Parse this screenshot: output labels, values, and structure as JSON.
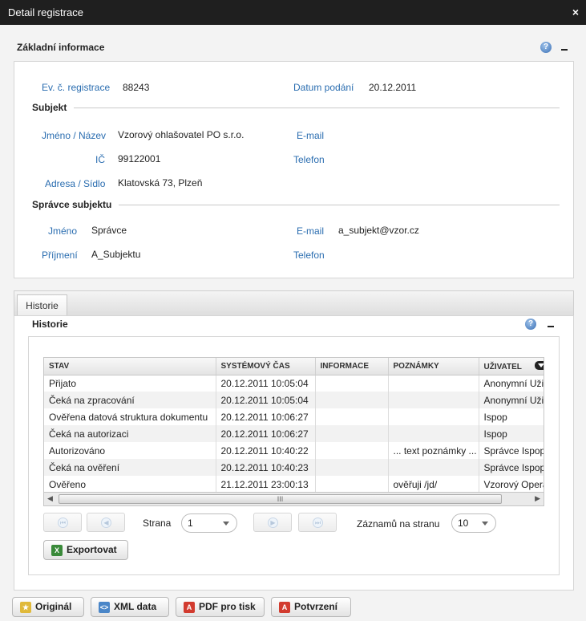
{
  "window": {
    "title": "Detail registrace",
    "close_symbol": "×"
  },
  "basic": {
    "title": "Základní informace",
    "evc_label": "Ev. č. registrace",
    "evc_value": "88243",
    "date_label": "Datum podání",
    "date_value": "20.12.2011",
    "subject": {
      "heading": "Subjekt",
      "name_label": "Jméno / Název",
      "name_value": "Vzorový ohlašovatel PO s.r.o.",
      "email_label": "E-mail",
      "email_value": "",
      "ic_label": "IČ",
      "ic_value": "99122001",
      "phone_label": "Telefon",
      "phone_value": "",
      "address_label": "Adresa / Sídlo",
      "address_value": "Klatovská 73, Plzeň"
    },
    "admin": {
      "heading": "Správce subjektu",
      "first_label": "Jméno",
      "first_value": "Správce",
      "email_label": "E-mail",
      "email_value": "a_subjekt@vzor.cz",
      "last_label": "Příjmení",
      "last_value": "A_Subjektu",
      "phone_label": "Telefon",
      "phone_value": ""
    }
  },
  "history": {
    "tab_label": "Historie",
    "title": "Historie",
    "columns": [
      "STAV",
      "SYSTÉMOVÝ ČAS",
      "INFORMACE",
      "POZNÁMKY",
      "UŽIVATEL"
    ],
    "rows": [
      [
        "Přijato",
        "20.12.2011 10:05:04",
        "",
        "",
        "Anonymní Uživatel"
      ],
      [
        "Čeká na zpracování",
        "20.12.2011 10:05:04",
        "",
        "",
        "Anonymní Uživatel"
      ],
      [
        "Ověřena datová struktura dokumentu",
        "20.12.2011 10:06:27",
        "",
        "",
        "Ispop"
      ],
      [
        "Čeká na autorizaci",
        "20.12.2011 10:06:27",
        "",
        "",
        "Ispop"
      ],
      [
        "Autorizováno",
        "20.12.2011 10:40:22",
        "",
        "... text poznámky ...",
        "Správce Ispop"
      ],
      [
        "Čeká na ověření",
        "20.12.2011 10:40:23",
        "",
        "",
        "Správce Ispop"
      ],
      [
        "Ověřeno",
        "21.12.2011 23:00:13",
        "",
        "ověřuji /jd/",
        "Vzorový Operátor"
      ]
    ],
    "scroll_grip": "III",
    "pager": {
      "page_label": "Strana",
      "page_value": "1",
      "per_page_label": "Záznamů na stranu",
      "per_page_value": "10"
    },
    "export_label": "Exportovat"
  },
  "footer": {
    "buttons": [
      "Originál",
      "XML data",
      "PDF pro tisk",
      "Potvrzení"
    ]
  },
  "colors": {
    "label_blue": "#2a6db0",
    "titlebar": "#1f1f1f"
  }
}
